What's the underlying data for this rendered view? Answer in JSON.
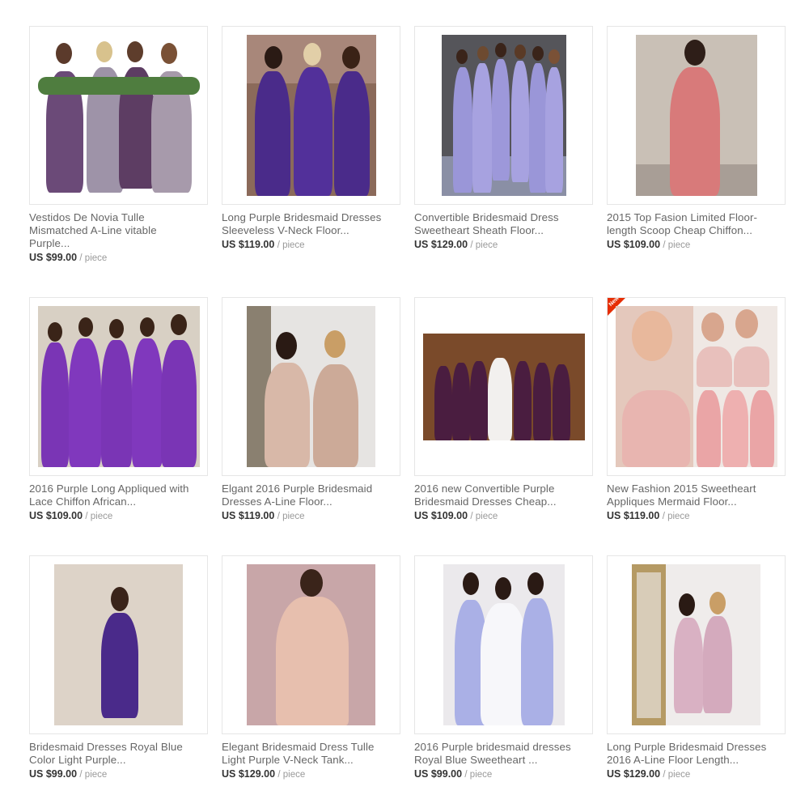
{
  "currency_prefix": "US $",
  "unit_label": "/ piece",
  "badge_new": "New",
  "products": [
    {
      "title_l1": "Vestidos De Novia Tulle",
      "title_l2": "Mismatched A-Line vitable",
      "title_l3": "Purple...",
      "price": "US $99.00",
      "unit": "/ piece"
    },
    {
      "title_l1": "Long Purple Bridesmaid Dresses",
      "title_l2": "Sleeveless V-Neck Floor...",
      "title_l3": "",
      "price": "US $119.00",
      "unit": "/ piece"
    },
    {
      "title_l1": "Convertible Bridesmaid Dress",
      "title_l2": "Sweetheart Sheath Floor...",
      "title_l3": "",
      "price": "US $129.00",
      "unit": "/ piece"
    },
    {
      "title_l1": "2015 Top Fasion Limited Floor-",
      "title_l2": "length Scoop Cheap Chiffon...",
      "title_l3": "",
      "price": "US $109.00",
      "unit": "/ piece"
    },
    {
      "title_l1": "2016 Purple Long Appliqued with",
      "title_l2": "Lace Chiffon African...",
      "title_l3": "",
      "price": "US $109.00",
      "unit": "/ piece"
    },
    {
      "title_l1": "Elgant 2016 Purple Bridesmaid",
      "title_l2": "Dresses A-Line Floor...",
      "title_l3": "",
      "price": "US $119.00",
      "unit": "/ piece"
    },
    {
      "title_l1": "2016 new Convertible Purple",
      "title_l2": "Bridesmaid Dresses Cheap...",
      "title_l3": "",
      "price": "US $109.00",
      "unit": "/ piece"
    },
    {
      "title_l1": "New Fashion 2015 Sweetheart",
      "title_l2": "Appliques Mermaid Floor...",
      "title_l3": "",
      "price": "US $119.00",
      "unit": "/ piece"
    },
    {
      "title_l1": "Bridesmaid Dresses Royal Blue",
      "title_l2": "Color Light Purple...",
      "title_l3": "",
      "price": "US $99.00",
      "unit": "/ piece"
    },
    {
      "title_l1": "Elegant Bridesmaid Dress Tulle",
      "title_l2": "Light Purple V-Neck Tank...",
      "title_l3": "",
      "price": "US $129.00",
      "unit": "/ piece"
    },
    {
      "title_l1": "2016 Purple bridesmaid dresses",
      "title_l2": "Royal Blue Sweetheart ...",
      "title_l3": "",
      "price": "US $99.00",
      "unit": "/ piece"
    },
    {
      "title_l1": "Long Purple Bridesmaid Dresses",
      "title_l2": "2016 A-Line Floor Length...",
      "title_l3": "",
      "price": "US $129.00",
      "unit": "/ piece"
    }
  ],
  "colors": {
    "title_text": "#666666",
    "price_text": "#333333",
    "unit_text": "#999999",
    "thumb_border": "#e6e6e6",
    "badge": "#e62e04"
  }
}
